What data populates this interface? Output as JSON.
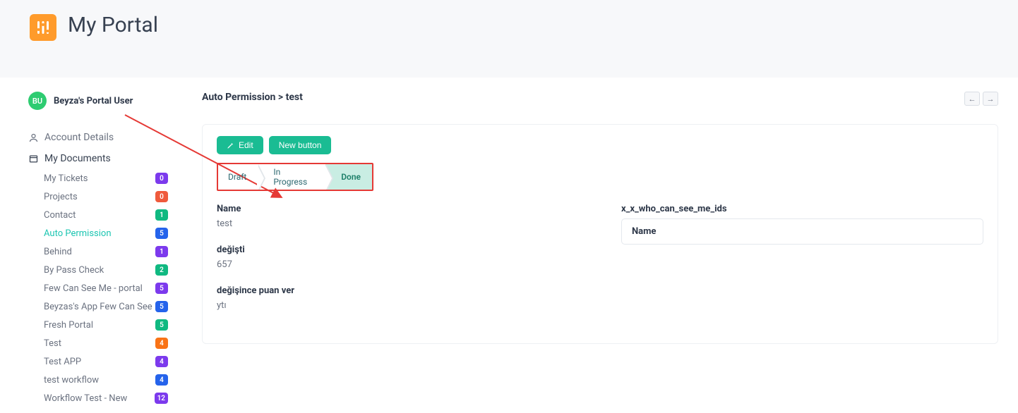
{
  "header": {
    "title": "My Portal"
  },
  "user": {
    "initials": "BU",
    "name": "Beyza's Portal User"
  },
  "nav": {
    "account_label": "Account Details",
    "documents_label": "My Documents",
    "items": [
      {
        "label": "My Tickets",
        "count": "0",
        "color": "#7c3aed"
      },
      {
        "label": "Projects",
        "count": "0",
        "color": "#ef5a3c"
      },
      {
        "label": "Contact",
        "count": "1",
        "color": "#10b981"
      },
      {
        "label": "Auto Permission",
        "count": "5",
        "color": "#2563eb",
        "selected": true
      },
      {
        "label": "Behind",
        "count": "1",
        "color": "#7c3aed"
      },
      {
        "label": "By Pass Check",
        "count": "2",
        "color": "#10b981"
      },
      {
        "label": "Few Can See Me - portal",
        "count": "5",
        "color": "#7c3aed"
      },
      {
        "label": "Beyzas's App Few Can See",
        "count": "5",
        "color": "#2563eb"
      },
      {
        "label": "Fresh Portal",
        "count": "5",
        "color": "#10b981"
      },
      {
        "label": "Test",
        "count": "4",
        "color": "#f97316"
      },
      {
        "label": "Test APP",
        "count": "4",
        "color": "#7c3aed"
      },
      {
        "label": "test workflow",
        "count": "4",
        "color": "#2563eb"
      },
      {
        "label": "Workflow Test - New",
        "count": "12",
        "color": "#7c3aed"
      }
    ]
  },
  "breadcrumb": {
    "text": "Auto Permission > test"
  },
  "actions": {
    "edit": "Edit",
    "new_button": "New button"
  },
  "stages": [
    {
      "label": "Draft",
      "active": false
    },
    {
      "label": "In Progress",
      "active": false
    },
    {
      "label": "Done",
      "active": true
    }
  ],
  "record": {
    "fields": [
      {
        "label": "Name",
        "value": "test"
      },
      {
        "label": "değişti",
        "value": "657"
      },
      {
        "label": "değişince puan ver",
        "value": "ytı"
      }
    ],
    "relation": {
      "title": "x_x_who_can_see_me_ids",
      "header": "Name"
    }
  }
}
